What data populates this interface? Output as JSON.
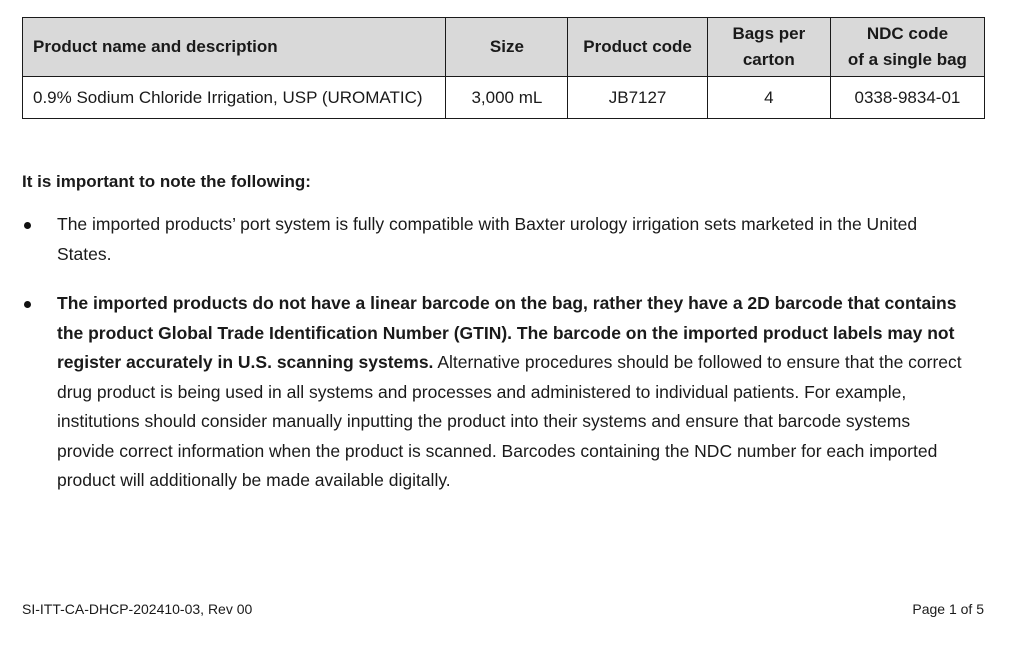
{
  "table": {
    "headers": [
      "Product name and description",
      "Size",
      "Product code",
      "Bags per carton",
      "NDC code of a single bag"
    ],
    "header_lines": {
      "bags_line1": "Bags per",
      "bags_line2": "carton",
      "ndc_line1": "NDC code",
      "ndc_line2": "of a single bag"
    },
    "rows": [
      {
        "name": "0.9% Sodium Chloride Irrigation, USP (UROMATIC)",
        "size": "3,000 mL",
        "code": "JB7127",
        "bags": "4",
        "ndc": "0338-9834-01"
      }
    ],
    "header_bg": "#d9d9d9"
  },
  "notes": {
    "heading": "It is important to note the following:",
    "items": [
      {
        "bold": "",
        "text": "The imported products’ port system is fully compatible with Baxter urology irrigation sets marketed in the United States."
      },
      {
        "bold": "The imported products do not have a linear barcode on the bag, rather they have a 2D barcode that contains the product Global Trade Identification Number (GTIN). The barcode on the imported product labels may not register accurately in U.S. scanning systems.",
        "text": " Alternative procedures should be followed to ensure that the correct drug product is being used in all systems and processes and administered to individual patients. For example, institutions should consider manually inputting the product into their systems and ensure that barcode systems provide correct information when the product is scanned. Barcodes containing the NDC number for each imported product will additionally be made available digitally."
      }
    ]
  },
  "footer": {
    "doc_id": "SI-ITT-CA-DHCP-202410-03, Rev 00",
    "page": "Page 1 of 5"
  }
}
